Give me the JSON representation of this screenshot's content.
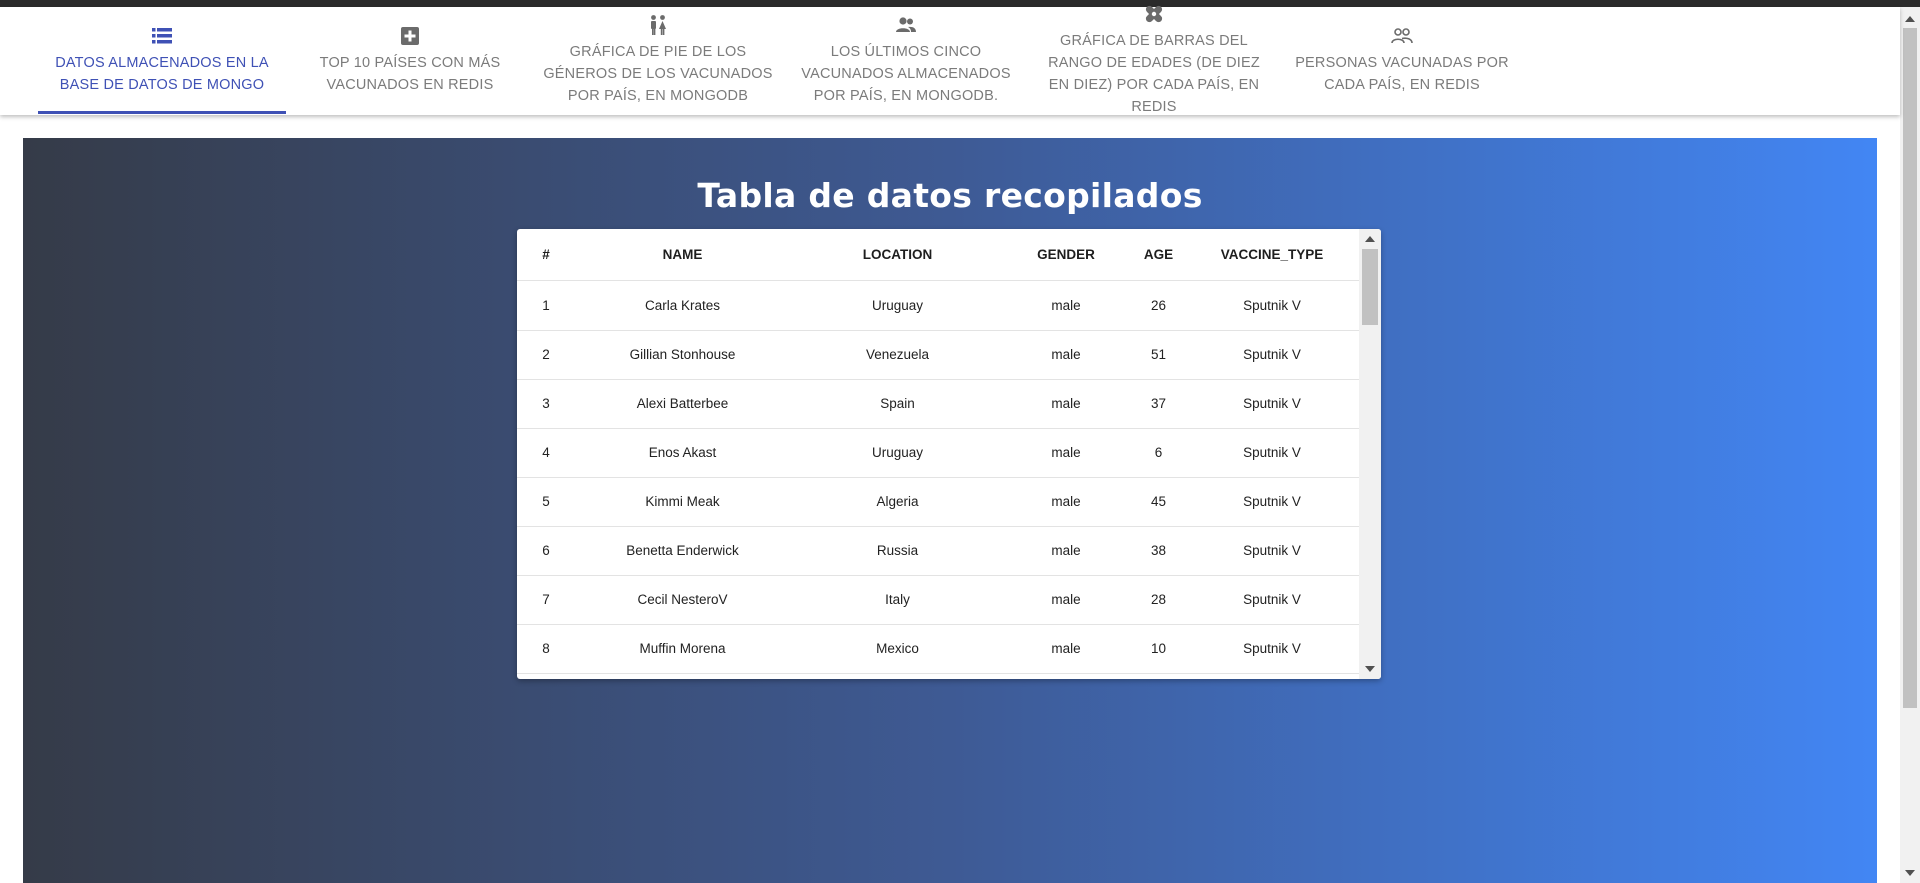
{
  "tabs": [
    {
      "label": "DATOS ALMACENADOS EN LA BASE DE DATOS DE MONGO",
      "icon": "list-icon",
      "active": true
    },
    {
      "label": "TOP 10 PAÍSES CON MÁS VACUNADOS EN REDIS",
      "icon": "plus-box-icon",
      "active": false
    },
    {
      "label": "GRÁFICA DE PIE DE LOS GÉNEROS DE LOS VACUNADOS POR PAÍS, EN MONGODB",
      "icon": "people-gender-icon",
      "active": false
    },
    {
      "label": "LOS ÚLTIMOS CINCO VACUNADOS ALMACENADOS POR PAÍS, EN MONGODB.",
      "icon": "people-icon",
      "active": false
    },
    {
      "label": "GRÁFICA DE BARRAS DEL RANGO DE EDADES (DE DIEZ EN DIEZ) POR CADA PAÍS, EN REDIS",
      "icon": "bandage-icon",
      "active": false
    },
    {
      "label": "PERSONAS VACUNADAS POR CADA PAÍS, EN REDIS",
      "icon": "people-outline-icon",
      "active": false
    }
  ],
  "main": {
    "title": "Tabla de datos recopilados"
  },
  "table": {
    "headers": [
      "#",
      "NAME",
      "LOCATION",
      "GENDER",
      "AGE",
      "VACCINE_TYPE"
    ],
    "rows": [
      [
        "1",
        "Carla Krates",
        "Uruguay",
        "male",
        "26",
        "Sputnik V"
      ],
      [
        "2",
        "Gillian Stonhouse",
        "Venezuela",
        "male",
        "51",
        "Sputnik V"
      ],
      [
        "3",
        "Alexi Batterbee",
        "Spain",
        "male",
        "37",
        "Sputnik V"
      ],
      [
        "4",
        "Enos Akast",
        "Uruguay",
        "male",
        "6",
        "Sputnik V"
      ],
      [
        "5",
        "Kimmi Meak",
        "Algeria",
        "male",
        "45",
        "Sputnik V"
      ],
      [
        "6",
        "Benetta Enderwick",
        "Russia",
        "male",
        "38",
        "Sputnik V"
      ],
      [
        "7",
        "Cecil NesteroV",
        "Italy",
        "male",
        "28",
        "Sputnik V"
      ],
      [
        "8",
        "Muffin Morena",
        "Mexico",
        "male",
        "10",
        "Sputnik V"
      ]
    ]
  },
  "colors": {
    "accent": "#3f51b5",
    "gradient_start": "#353b48",
    "gradient_end": "#4286f4"
  }
}
